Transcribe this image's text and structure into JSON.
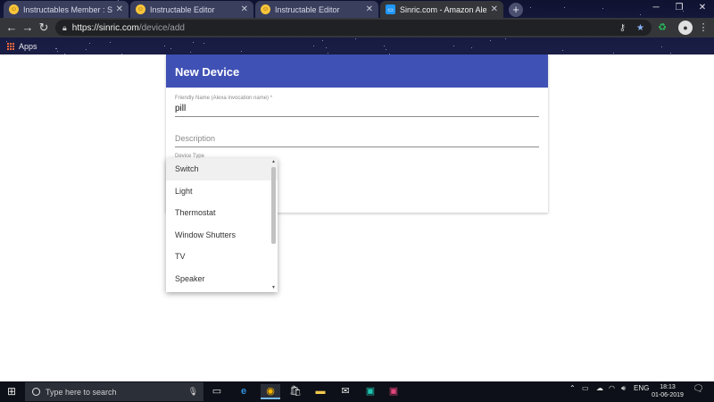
{
  "browser": {
    "tabs": [
      {
        "title": "Instructables Member : Sparstill",
        "favicon": "instructables-icon"
      },
      {
        "title": "Instructable Editor",
        "favicon": "instructables-icon"
      },
      {
        "title": "Instructable Editor",
        "favicon": "instructables-icon"
      },
      {
        "title": "Sinric.com - Amazon Alexa Smar",
        "favicon": "sinric-icon"
      }
    ],
    "new_tab_label": "+",
    "address": {
      "host": "https://sinric.com",
      "path": "/device/add"
    },
    "bookmarks": {
      "apps_label": "Apps"
    }
  },
  "form": {
    "title": "New Device",
    "friendly_name_label": "Friendly Name (Alexa invocation name) *",
    "friendly_name_value": "pill",
    "description_placeholder": "Description",
    "device_type_label": "Device Type"
  },
  "dropdown": {
    "options": [
      "Switch",
      "Light",
      "Thermostat",
      "Window Shutters",
      "TV",
      "Speaker"
    ],
    "highlighted": "Switch"
  },
  "taskbar": {
    "search_placeholder": "Type here to search",
    "language": "ENG",
    "time": "18:13",
    "date": "01-06-2019"
  },
  "colors": {
    "header": "#3f51b5",
    "browser_frame": "#161a3e"
  }
}
